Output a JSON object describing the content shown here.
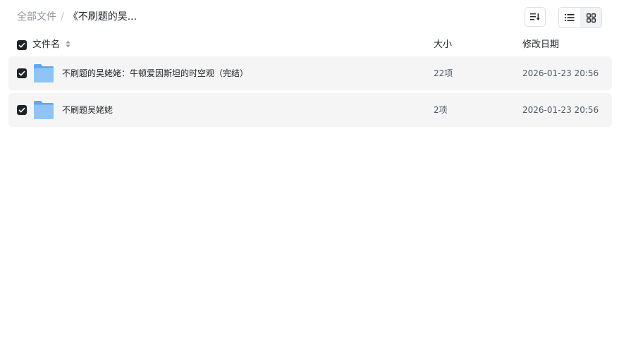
{
  "breadcrumb": {
    "root": "全部文件",
    "separator": "/",
    "current": "《不刷题的吴..."
  },
  "toolbar": {
    "sort_icon": "sort-icon",
    "list_view_icon": "list-view-icon",
    "grid_view_icon": "grid-view-icon"
  },
  "header": {
    "name": "文件名",
    "size": "大小",
    "date": "修改日期"
  },
  "files": [
    {
      "name": "不刷题的吴姥姥：牛顿爱因斯坦的时空观（完结）",
      "size": "22项",
      "date": "2026-01-23 20:56",
      "type": "folder",
      "checked": true
    },
    {
      "name": "不刷题吴姥姥",
      "size": "2项",
      "date": "2026-01-23 20:56",
      "type": "folder",
      "checked": true
    }
  ],
  "colors": {
    "row_bg": "#f5f5f5",
    "checkbox": "#1f2329",
    "folder_front": "#8ec5f6",
    "folder_back": "#5ea8ee"
  }
}
